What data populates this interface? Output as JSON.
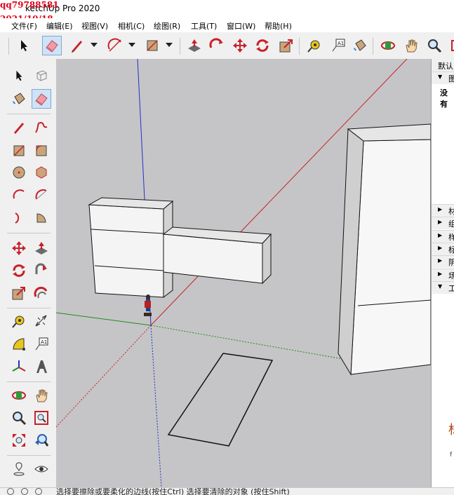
{
  "window": {
    "app_title": "ketchUp Pro 2020",
    "watermark_line1": "qq79788581",
    "watermark_line2": "2021/10/18"
  },
  "menu": [
    "文件(F)",
    "编辑(E)",
    "视图(V)",
    "相机(C)",
    "绘图(R)",
    "工具(T)",
    "窗口(W)",
    "帮助(H)"
  ],
  "toolbar": {
    "icons": [
      "select-icon",
      "eraser-icon",
      "pencil-icon",
      "arc-icon",
      "rectangle-icon",
      "push-pull-icon",
      "follow-me-icon",
      "move-icon",
      "rotate-icon",
      "scale-icon",
      "tape-measure-icon",
      "text-icon",
      "paint-bucket-icon",
      "orbit-icon",
      "pan-icon",
      "zoom-icon",
      "zoom-extents-icon"
    ],
    "active": "eraser-icon"
  },
  "palette": {
    "active": "eraser-icon"
  },
  "panel": {
    "header": "默认",
    "default_section": "图",
    "empty_text": "没有",
    "sections": [
      "材",
      "组",
      "样",
      "标",
      "阴",
      "场",
      "工"
    ],
    "big_text": "标",
    "small_text": "f"
  },
  "status": {
    "text": "选择要擦除或要柔化的边线(按住Ctrl) 选择要清除的对象 (按住Shift)"
  },
  "colors": {
    "viewport_bg": "#c5c5c7",
    "axis_red": "#c8202a",
    "axis_green": "#1f8a1f",
    "axis_blue": "#2030c8",
    "active_tool_bg": "#cfe3f7",
    "watermark": "#e0001a"
  }
}
